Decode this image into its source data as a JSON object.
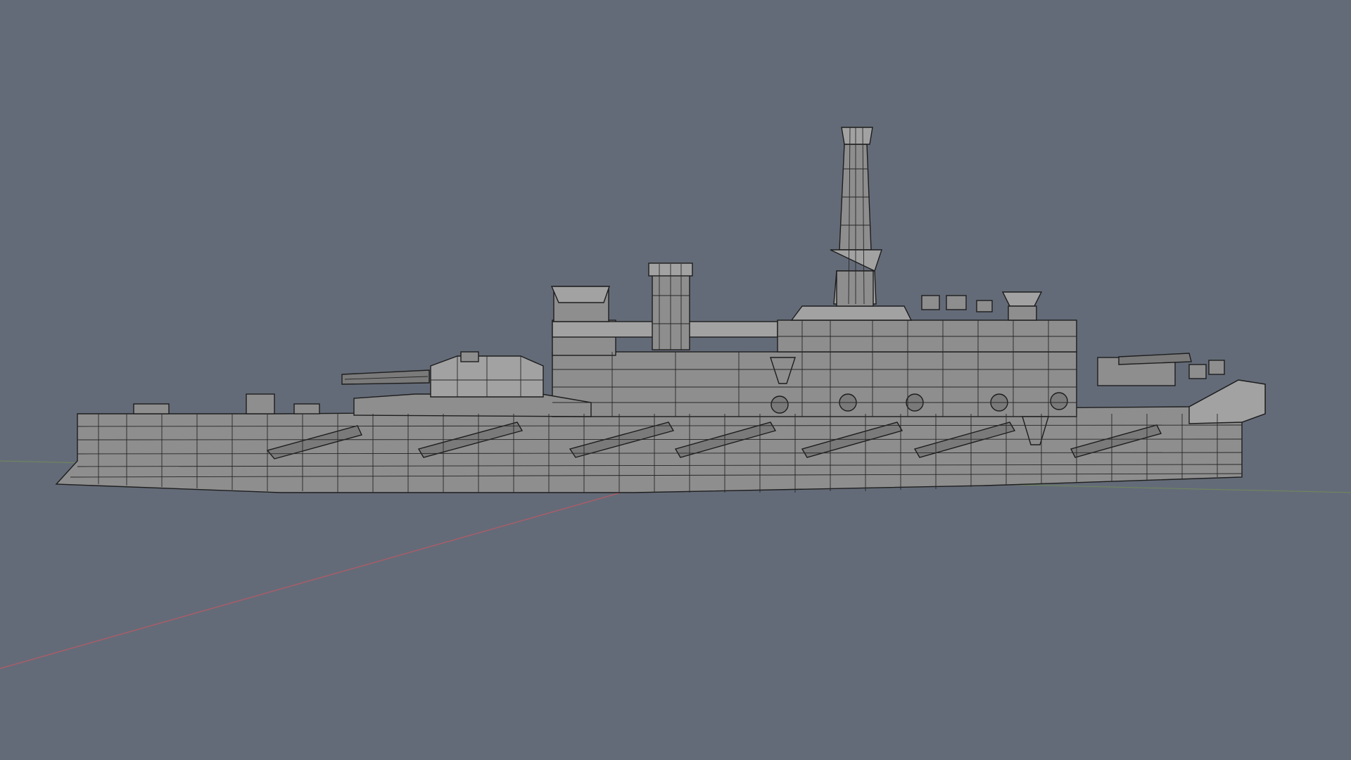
{
  "viewport": {
    "background": "#646b78",
    "mesh_fill": "#8e8e8e",
    "wire_color": "#1d1d1d",
    "x_axis_color": "#b55a66",
    "y_axis_color": "#6f8a5a",
    "subject": "battleship-model-wireframe"
  }
}
